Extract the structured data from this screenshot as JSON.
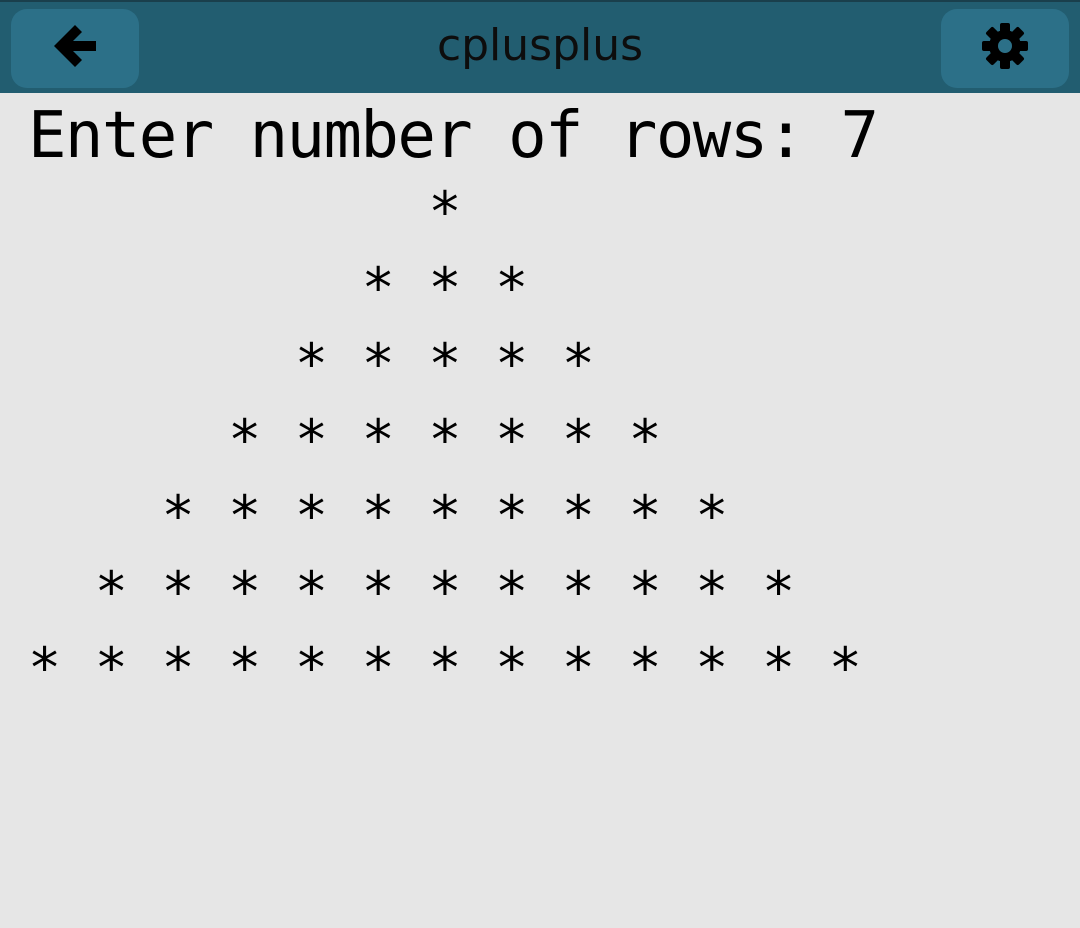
{
  "app_bar": {
    "title": "cplusplus",
    "back_icon": "arrow-left-icon",
    "settings_icon": "gear-icon",
    "background_color": "#225d70",
    "button_color": "#2c7088"
  },
  "console": {
    "background_color": "#e6e6e6",
    "prompt": "Enter number of rows: 7",
    "pattern_lines": [
      "            *",
      "          * * *",
      "        * * * * *",
      "      * * * * * * *",
      "    * * * * * * * * *",
      "  * * * * * * * * * * *",
      "* * * * * * * * * * * * *"
    ]
  }
}
